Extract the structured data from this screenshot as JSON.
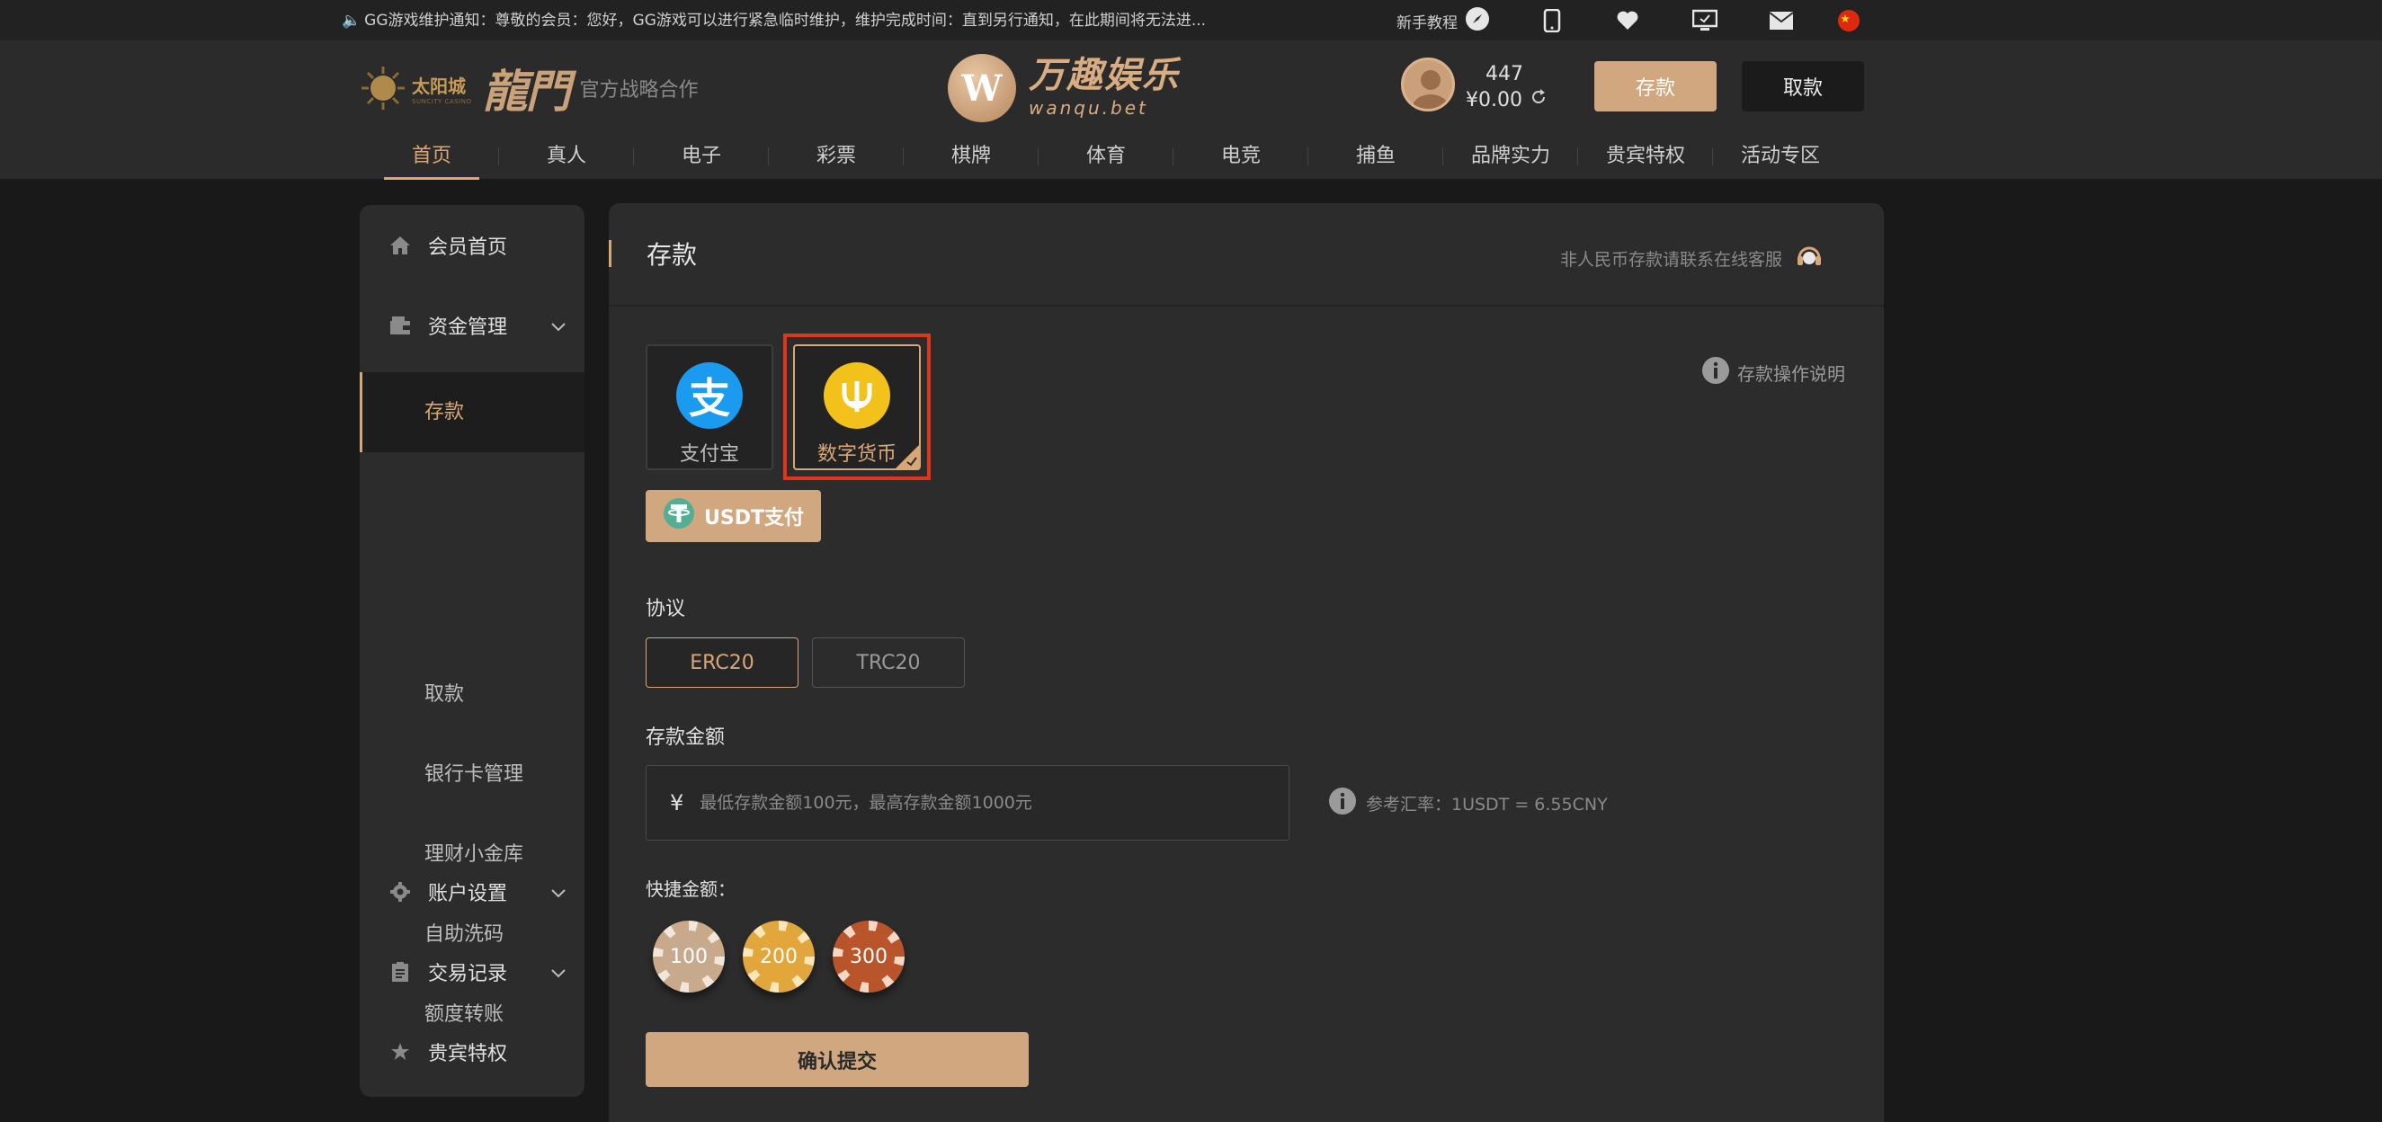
{
  "notice": {
    "text": "GG游戏维护通知：尊敬的会员：您好，GG游戏可以进行紧急临时维护，维护完成时间：直到另行通知，在此期间将无法进...",
    "newbie_label": "新手教程"
  },
  "header": {
    "partner_logo_1": "太阳城",
    "partner_logo_1_sub": "SUNCITY CASINO",
    "partner_logo_2": "龍門",
    "partner_text": "官方战略合作",
    "brand_name": "万趣娱乐",
    "brand_url": "wanqu.bet",
    "brand_badge": "W",
    "username": "447",
    "balance": "¥0.00",
    "deposit_label": "存款",
    "withdraw_label": "取款"
  },
  "nav": {
    "items": [
      "首页",
      "真人",
      "电子",
      "彩票",
      "棋牌",
      "体育",
      "电竞",
      "捕鱼",
      "品牌实力",
      "贵宾特权",
      "活动专区"
    ]
  },
  "sidebar": {
    "member_home": "会员首页",
    "funds": "资金管理",
    "funds_sub": [
      "存款",
      "取款",
      "银行卡管理",
      "理财小金库",
      "自助洗码",
      "额度转账"
    ],
    "account_settings": "账户设置",
    "transactions": "交易记录",
    "vip": "贵宾特权"
  },
  "main": {
    "title": "存款",
    "service_note": "非人民币存款请联系在线客服",
    "ops_help": "存款操作说明",
    "methods": [
      {
        "label": "支付宝",
        "icon": "alipay-icon"
      },
      {
        "label": "数字货币",
        "icon": "crypto-icon"
      }
    ],
    "usdt_label": "USDT支付",
    "protocol_label": "协议",
    "protocols": [
      "ERC20",
      "TRC20"
    ],
    "amount_label": "存款金额",
    "currency_symbol": "¥",
    "amount_placeholder": "最低存款金额100元，最高存款金额1000元",
    "rate_text": "参考汇率：1USDT = 6.55CNY",
    "quick_label": "快捷金额：",
    "quick_amounts": [
      "100",
      "200",
      "300"
    ],
    "submit_label": "确认提交"
  },
  "colors": {
    "accent": "#d9a776",
    "button": "#d1a77f",
    "highlight": "#e0351c",
    "alipay": "#1a9bf0",
    "crypto": "#f2c21b"
  }
}
